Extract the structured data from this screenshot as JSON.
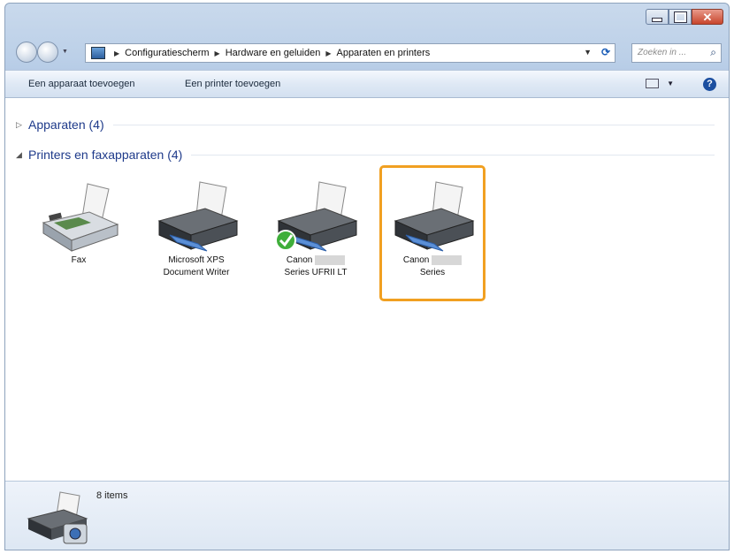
{
  "window": {
    "breadcrumb": [
      "Configuratiescherm",
      "Hardware en geluiden",
      "Apparaten en printers"
    ],
    "search_placeholder": "Zoeken in ..."
  },
  "toolbar": {
    "add_device": "Een apparaat toevoegen",
    "add_printer": "Een printer toevoegen"
  },
  "groups": {
    "devices": "Apparaten (4)",
    "printers": "Printers en faxapparaten (4)"
  },
  "printers": [
    {
      "line1": "Fax",
      "line2": "",
      "icon": "fax-icon",
      "default": false,
      "selected": false
    },
    {
      "line1": "Microsoft XPS",
      "line2": "Document Writer",
      "icon": "printer-icon",
      "default": false,
      "selected": false
    },
    {
      "line1": "Canon",
      "line2": "Series UFRII LT",
      "icon": "printer-icon",
      "default": true,
      "selected": false
    },
    {
      "line1": "Canon",
      "line2": "Series",
      "icon": "printer-icon",
      "default": false,
      "selected": true
    }
  ],
  "details": {
    "count": "8 items"
  },
  "colors": {
    "selection": "#f1a021",
    "link": "#1e3a8a"
  }
}
